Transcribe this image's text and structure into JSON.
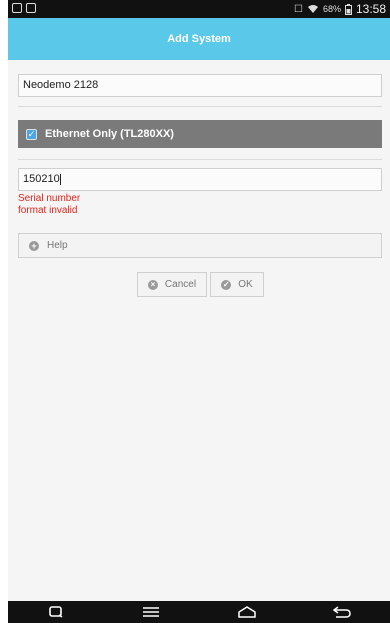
{
  "status_bar": {
    "battery_percent": "68%",
    "time": "13:58"
  },
  "title_bar": {
    "title": "Add System"
  },
  "form": {
    "name_value": "Neodemo 2128",
    "ethernet_only_label": "Ethernet Only (TL280XX)",
    "ethernet_only_checked": true,
    "serial_value": "150210",
    "serial_error_line1": "Serial number",
    "serial_error_line2": "format invalid",
    "help_label": "Help"
  },
  "actions": {
    "cancel_label": "Cancel",
    "ok_label": "OK"
  },
  "colors": {
    "title_bar_bg": "#5ac8e8",
    "error_text": "#e3251c",
    "checkbox_accent": "#4aa6e6"
  },
  "navigation_icons": [
    "recent-apps-icon",
    "menu-icon",
    "home-icon",
    "back-icon"
  ]
}
